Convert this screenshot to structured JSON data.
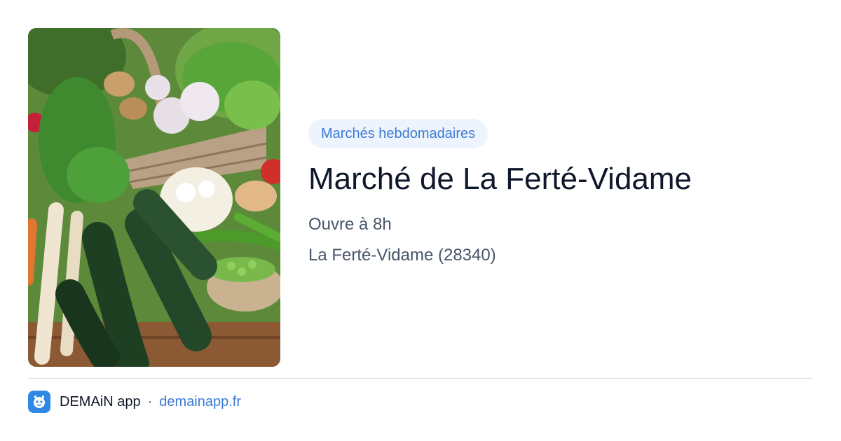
{
  "hero": {
    "image_description": "Basket of fresh vegetables: zucchini, parsnips, cauliflower, garlic, peas, radishes, herbs"
  },
  "category_badge": "Marchés hebdomadaires",
  "title": "Marché de La Ferté-Vidame",
  "opening": "Ouvre à 8h",
  "location": "La Ferté-Vidame (28340)",
  "footer": {
    "brand": "DEMAiN app",
    "separator": "·",
    "url": "demainapp.fr"
  },
  "colors": {
    "accent": "#3b7bd4",
    "badge_bg": "#eef4fd",
    "logo_bg": "#2f87e6"
  }
}
